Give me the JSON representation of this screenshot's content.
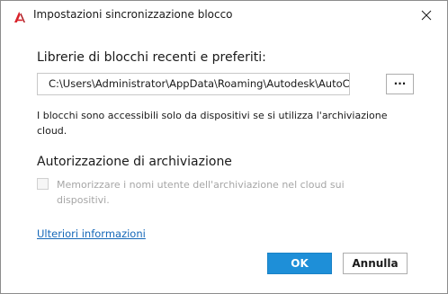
{
  "window": {
    "title": "Impostazioni sincronizzazione blocco",
    "icon": "autocad-logo-icon",
    "close_icon": "close-icon"
  },
  "libraries": {
    "heading": "Librerie di blocchi recenti e preferiti:",
    "path_value": "C:\\Users\\Administrator\\AppData\\Roaming\\Autodesk\\AutoCAD",
    "browse_label": "...",
    "info": "I blocchi sono accessibili solo da dispositivi se si utilizza l'archiviazione cloud."
  },
  "authorization": {
    "heading": "Autorizzazione di archiviazione",
    "checkbox_label": "Memorizzare i nomi utente dell'archiviazione nel cloud sui dispositivi.",
    "checked": false,
    "enabled": false
  },
  "footer": {
    "link_label": "Ulteriori informazioni",
    "ok_label": "OK",
    "cancel_label": "Annulla"
  },
  "colors": {
    "accent": "#1e8fd8",
    "link": "#1467b8",
    "brand_icon": "#d8222a"
  }
}
